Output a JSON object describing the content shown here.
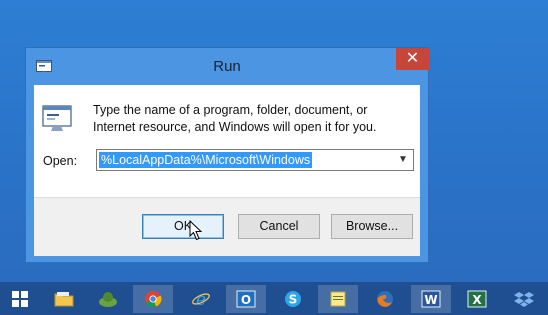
{
  "dialog": {
    "title": "Run",
    "close_glyph": "✕",
    "description": "Type the name of a program, folder, document, or Internet resource, and Windows will open it for you.",
    "open_label": "Open:",
    "open_value": "%LocalAppData%\\Microsoft\\Windows",
    "buttons": {
      "ok": "OK",
      "cancel": "Cancel",
      "browse": "Browse..."
    }
  },
  "taskbar": {
    "items": [
      {
        "icon": "windows-start-icon"
      },
      {
        "icon": "file-explorer-icon"
      },
      {
        "icon": "xbox-games-icon"
      },
      {
        "icon": "chrome-icon"
      },
      {
        "icon": "internet-explorer-icon"
      },
      {
        "icon": "outlook-icon"
      },
      {
        "icon": "skype-icon"
      },
      {
        "icon": "notes-icon"
      },
      {
        "icon": "firefox-icon"
      },
      {
        "icon": "word-icon"
      },
      {
        "icon": "excel-icon"
      },
      {
        "icon": "dropbox-icon"
      }
    ],
    "word_letter": "W",
    "excel_letter": "X",
    "outlook_letter": "O"
  },
  "colors": {
    "desktop": "#2b73c9",
    "window_frame": "#4c95e3",
    "close_button": "#c7463a",
    "selection": "#3399ff",
    "taskbar": "#1f4f91"
  }
}
